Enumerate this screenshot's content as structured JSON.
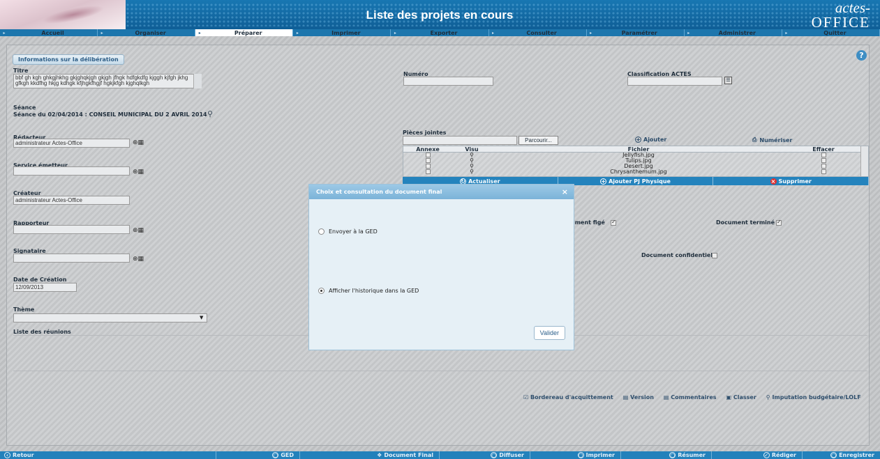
{
  "header": {
    "title": "Liste des projets en cours",
    "brand_top": "actes-",
    "brand_bottom": "OFFICE"
  },
  "nav": {
    "items": [
      "Accueil",
      "Organiser",
      "Préparer",
      "Imprimer",
      "Exporter",
      "Consulter",
      "Paramétrer",
      "Administrer",
      "Quitter"
    ],
    "active_index": 2
  },
  "form": {
    "section_label": "Informations sur la délibération",
    "help_icon": "?",
    "titre_label": "Titre",
    "titre_value": "bbf gh kgh ghkgjhkhg gkjghqkjgh gkjgh jfhgk hdfgkdfg kjggh kjfgh jkhg gfkgh  kkdfhg hkjg kdhgk kfjhgkfhgjf hgkjkfgh kjghqlkgh",
    "numero_label": "Numéro",
    "numero_value": "",
    "classification_label": "Classification ACTES",
    "classification_value": "",
    "seance_label": "Séance",
    "seance_value": "Séance du 02/04/2014 : CONSEIL MUNICIPAL DU 2 AVRIL 2014",
    "redacteur_label": "Rédacteur",
    "redacteur_value": "administrateur Actes-Office",
    "service_label": "Service émetteur",
    "service_value": "",
    "createur_label": "Créateur",
    "createur_value": "administrateur Actes-Office",
    "rapporteur_label": "Rapporteur",
    "rapporteur_value": "",
    "signataire_label": "Signataire",
    "signataire_value": "",
    "date_label": "Date de Création",
    "date_value": "12/09/2013",
    "theme_label": "Thème",
    "theme_value": "",
    "reunions_label": "Liste des réunions",
    "doc_fige_label": "ument figé",
    "doc_termine_label": "Document terminé",
    "doc_confidentiel_label": "Document confidentiel"
  },
  "pieces": {
    "label": "Pièces jointes",
    "browse_label": "Parcourir...",
    "ajouter_label": "Ajouter",
    "numeriser_label": "Numériser",
    "columns": [
      "Annexe",
      "Visu",
      "Fichier",
      "Effacer"
    ],
    "files": [
      "Jellyfish.jpg",
      "Tulips.jpg",
      "Desert.jpg",
      "Chrysanthemum.jpg"
    ],
    "actions": [
      "Actualiser",
      "Ajouter PJ Physique",
      "Supprimer"
    ]
  },
  "bottom_links": [
    "Bordereau d'acquittement",
    "Version",
    "Commentaires",
    "Classer",
    "Imputation budgétaire/LOLF"
  ],
  "footer": [
    "Retour",
    "GED",
    "Document Final",
    "Diffuser",
    "Imprimer",
    "Résumer",
    "Rédiger",
    "Enregistrer"
  ],
  "modal": {
    "title": "Choix et consultation du document final",
    "close": "×",
    "option1": "Envoyer à la GED",
    "option2": "Afficher l'historique dans la GED",
    "selected": 2,
    "button": "Valider"
  },
  "colors": {
    "nav_blue": "#1d76ad",
    "footer_blue": "#2381bb",
    "modal_title": "#8fc0e0"
  }
}
